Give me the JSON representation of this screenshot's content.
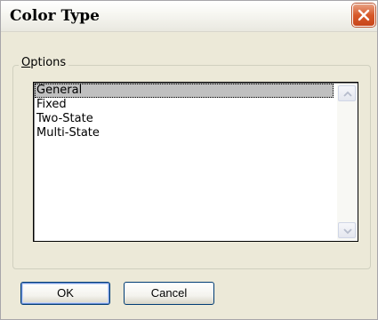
{
  "window": {
    "title": "Color Type",
    "close_icon": "close-icon"
  },
  "options": {
    "legend_mnemonic": "O",
    "legend_rest": "ptions",
    "items": [
      "General",
      "Fixed",
      "Two-State",
      "Multi-State"
    ],
    "selected": "General"
  },
  "buttons": {
    "ok_label": "OK",
    "cancel_label": "Cancel"
  },
  "colors": {
    "close_button": "#d7592a",
    "selection": "#c0c0c0",
    "dialog_bg": "#ece9d8"
  }
}
